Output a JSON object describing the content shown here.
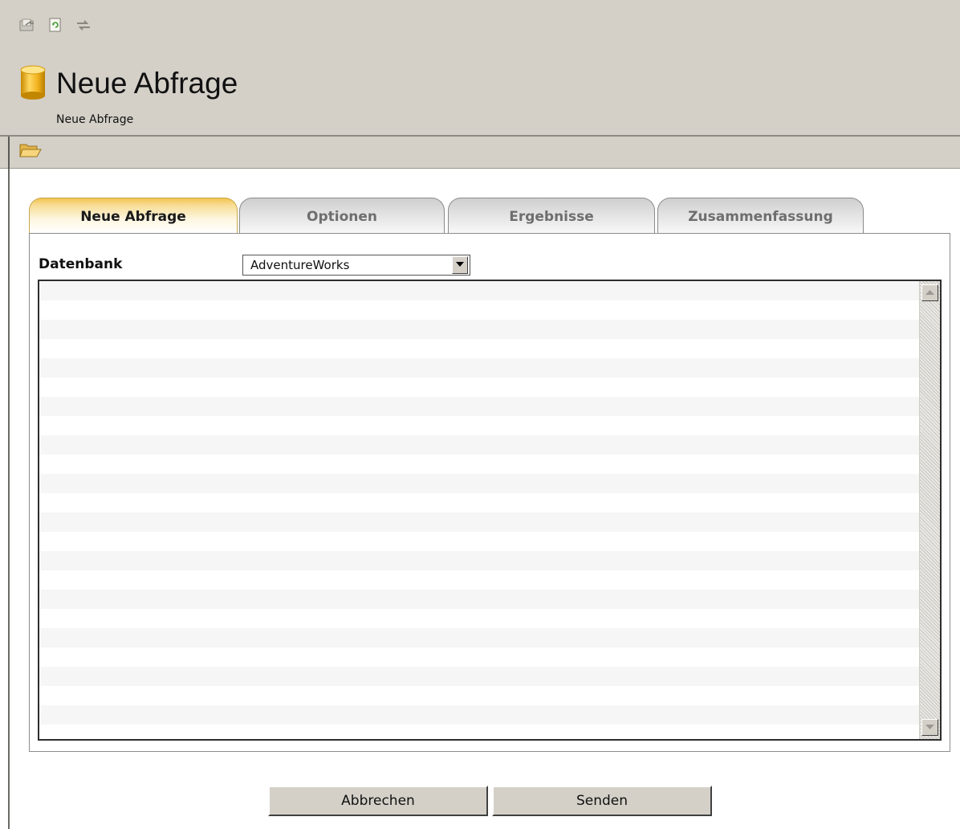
{
  "header": {
    "title": "Neue Abfrage",
    "subtitle": "Neue Abfrage",
    "toolbar_icons": [
      "export-icon",
      "refresh-icon",
      "sync-icon"
    ]
  },
  "toolbar": {
    "icons": [
      "open-folder-icon"
    ]
  },
  "tabs": [
    {
      "label": "Neue Abfrage",
      "active": true
    },
    {
      "label": "Optionen",
      "active": false
    },
    {
      "label": "Ergebnisse",
      "active": false
    },
    {
      "label": "Zusammenfassung",
      "active": false
    }
  ],
  "form": {
    "database_label": "Datenbank",
    "database_value": "AdventureWorks"
  },
  "buttons": {
    "cancel": "Abbrechen",
    "submit": "Senden"
  },
  "colors": {
    "chrome": "#d4d0c8",
    "tab_active": "#f2c44e",
    "db_icon": "#f0b21e"
  }
}
